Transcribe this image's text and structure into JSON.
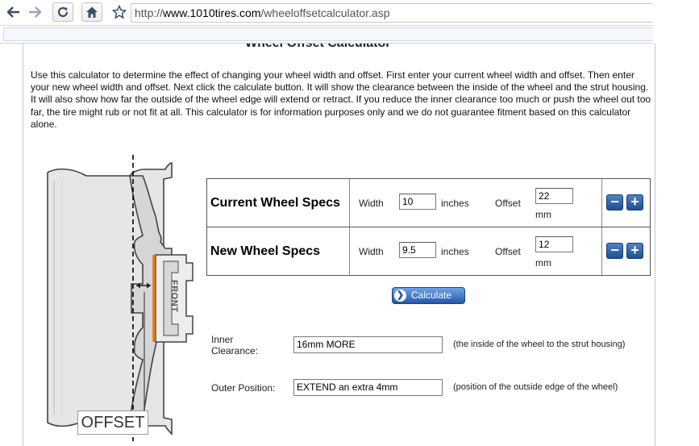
{
  "browser": {
    "url_scheme": "http://",
    "url_host": "www.1010tires.com",
    "url_path": "/wheeloffsetcalculator.asp"
  },
  "page": {
    "title": "Wheel Offset Calculator",
    "intro": "Use this calculator to determine the effect of changing your wheel width and offset. First enter your current wheel width and offset. Then enter your new wheel width and offset. Next click the calculate button. It will show the clearance between the inside of the wheel and the strut housing. It will also show how far the outside of the wheel edge will extend or retract. If you reduce the inner clearance too much or push the wheel out too far, the tire might rub or not fit at all. This calculator is for information purposes only and we do not guarantee fitment based on this calculator alone."
  },
  "diagram": {
    "front_label": "FRONT",
    "offset_label": "OFFSET"
  },
  "specs": {
    "current": {
      "title": "Current Wheel Specs",
      "width_label": "Width",
      "width_value": "10",
      "width_unit": "inches",
      "offset_label": "Offset",
      "offset_value": "22",
      "offset_unit": "mm"
    },
    "new": {
      "title": "New Wheel Specs",
      "width_label": "Width",
      "width_value": "9.5",
      "width_unit": "inches",
      "offset_label": "Offset",
      "offset_value": "12",
      "offset_unit": "mm"
    },
    "minus": "−",
    "plus": "+"
  },
  "calculate": {
    "label": "Calculate"
  },
  "results": {
    "inner_label": "Inner Clearance:",
    "inner_value": "16mm MORE",
    "inner_note": "(the inside of the wheel to the strut housing)",
    "outer_label": "Outer Position:",
    "outer_value": "EXTEND an extra 4mm",
    "outer_note": "(position of the outside edge of the wheel)"
  },
  "colors": {
    "button_blue": "#2458a8",
    "marker_orange": "#e8760a"
  }
}
